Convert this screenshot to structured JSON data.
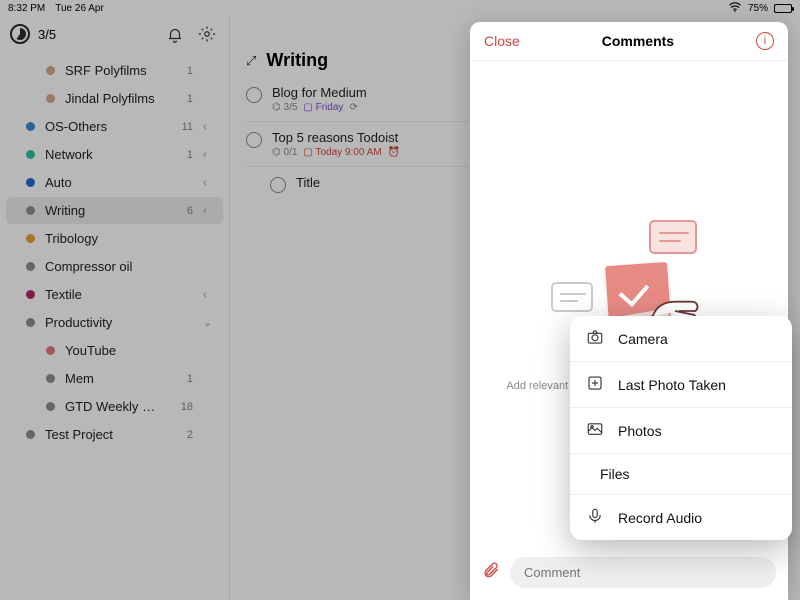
{
  "statusbar": {
    "time": "8:32 PM",
    "date": "Tue 26 Apr",
    "battery": "75%"
  },
  "sidebar": {
    "counter": "3/5",
    "items": [
      {
        "label": "SRF Polyfilms",
        "count": "1",
        "color": "#d7a88a",
        "indent": true,
        "chev": ""
      },
      {
        "label": "Jindal Polyfilms",
        "count": "1",
        "color": "#d7a88a",
        "indent": true,
        "chev": ""
      },
      {
        "label": "OS-Others",
        "count": "11",
        "color": "#3a8ad2",
        "indent": false,
        "chev": "‹"
      },
      {
        "label": "Network",
        "count": "1",
        "color": "#2dbf9f",
        "indent": false,
        "chev": "‹"
      },
      {
        "label": "Auto",
        "count": "",
        "color": "#1f6bd0",
        "indent": false,
        "chev": "‹"
      },
      {
        "label": "Writing",
        "count": "6",
        "color": "#8e8e8e",
        "indent": false,
        "chev": "‹",
        "active": true
      },
      {
        "label": "Tribology",
        "count": "",
        "color": "#e6a23c",
        "indent": false,
        "chev": ""
      },
      {
        "label": "Compressor oil",
        "count": "",
        "color": "#8e8e8e",
        "indent": false,
        "chev": ""
      },
      {
        "label": "Textile",
        "count": "",
        "color": "#b02a6a",
        "indent": false,
        "chev": "‹"
      },
      {
        "label": "Productivity",
        "count": "",
        "color": "#8e8e8e",
        "indent": false,
        "chev": "⌄"
      },
      {
        "label": "YouTube",
        "count": "",
        "color": "#e07b7b",
        "indent": true,
        "chev": ""
      },
      {
        "label": "Mem",
        "count": "1",
        "color": "#8e8e8e",
        "indent": true,
        "chev": ""
      },
      {
        "label": "GTD Weekly Review",
        "count": "18",
        "color": "#8e8e8e",
        "indent": true,
        "chev": ""
      },
      {
        "label": "Test Project",
        "count": "2",
        "color": "#8e8e8e",
        "indent": false,
        "chev": ""
      }
    ]
  },
  "main": {
    "title": "Writing",
    "tasks": [
      {
        "title": "Blog for Medium",
        "sub": "3/5",
        "date_label": "Friday",
        "date_style": "friday",
        "repeat": true,
        "indent": false
      },
      {
        "title": "Top 5 reasons Todoist",
        "sub": "0/1",
        "date_label": "Today 9:00 AM",
        "date_style": "today",
        "repeat": false,
        "reminder": true,
        "indent": false
      },
      {
        "title": "Title",
        "sub": "",
        "date_label": "",
        "date_style": "",
        "indent": true
      }
    ]
  },
  "panel": {
    "close": "Close",
    "title": "Comments",
    "empty": "Add relevant notes, links, files, photos, or anything",
    "input_placeholder": "Comment"
  },
  "popup": {
    "items": [
      {
        "icon": "camera",
        "label": "Camera"
      },
      {
        "icon": "last-photo",
        "label": "Last Photo Taken"
      },
      {
        "icon": "photos",
        "label": "Photos"
      },
      {
        "icon": "files",
        "label": "Files"
      },
      {
        "icon": "mic",
        "label": "Record Audio"
      }
    ]
  }
}
